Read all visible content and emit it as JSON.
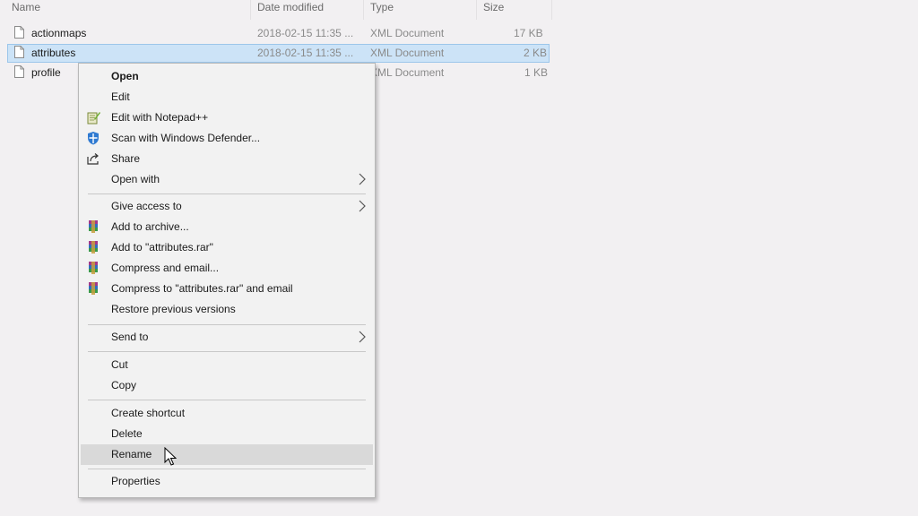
{
  "columns": {
    "name": "Name",
    "date_modified": "Date modified",
    "type": "Type",
    "size": "Size"
  },
  "files": [
    {
      "name": "actionmaps",
      "date": "2018-02-15 11:35 ...",
      "type": "XML Document",
      "size": "17 KB",
      "selected": false
    },
    {
      "name": "attributes",
      "date": "2018-02-15 11:35 ...",
      "type": "XML Document",
      "size": "2 KB",
      "selected": true
    },
    {
      "name": "profile",
      "date": "",
      "type": "XML Document",
      "size": "1 KB",
      "selected": false
    }
  ],
  "context_menu": {
    "items": [
      {
        "label": "Open",
        "icon": "",
        "bold": true
      },
      {
        "label": "Edit",
        "icon": ""
      },
      {
        "label": "Edit with Notepad++",
        "icon": "notepad-plus-plus-icon"
      },
      {
        "label": "Scan with Windows Defender...",
        "icon": "windows-defender-icon"
      },
      {
        "label": "Share",
        "icon": "share-icon"
      },
      {
        "label": "Open with",
        "icon": "",
        "submenu": true
      },
      {
        "label": "Give access to",
        "icon": "",
        "submenu": true
      },
      {
        "label": "Add to archive...",
        "icon": "winrar-icon"
      },
      {
        "label": "Add to \"attributes.rar\"",
        "icon": "winrar-icon"
      },
      {
        "label": "Compress and email...",
        "icon": "winrar-icon"
      },
      {
        "label": "Compress to \"attributes.rar\" and email",
        "icon": "winrar-icon"
      },
      {
        "label": "Restore previous versions",
        "icon": ""
      },
      {
        "label": "Send to",
        "icon": "",
        "submenu": true
      },
      {
        "label": "Cut",
        "icon": ""
      },
      {
        "label": "Copy",
        "icon": ""
      },
      {
        "label": "Create shortcut",
        "icon": ""
      },
      {
        "label": "Delete",
        "icon": ""
      },
      {
        "label": "Rename",
        "icon": "",
        "hovered": true
      },
      {
        "label": "Properties",
        "icon": ""
      }
    ]
  },
  "colors": {
    "selection": "#cce3f7",
    "hover": "#d9d9d9",
    "menu_bg": "#f2f2f2"
  }
}
